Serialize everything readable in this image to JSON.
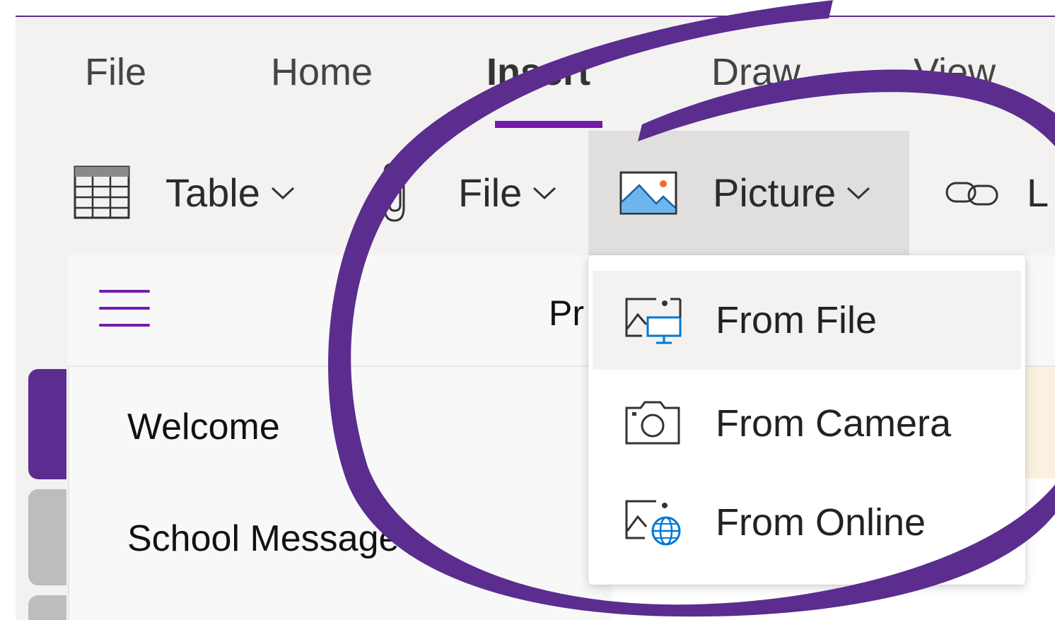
{
  "ribbon": {
    "tabs": [
      {
        "label": "File"
      },
      {
        "label": "Home"
      },
      {
        "label": "Insert",
        "active": true
      },
      {
        "label": "Draw"
      },
      {
        "label": "View"
      }
    ],
    "commands": {
      "table": "Table",
      "file": "File",
      "picture": "Picture",
      "link": "L"
    }
  },
  "navigation": {
    "page_title_partial": "Pr",
    "pages": [
      "Welcome",
      "School Messages"
    ]
  },
  "picture_menu": {
    "items": [
      {
        "label": "From File",
        "icon": "picture-from-file-icon"
      },
      {
        "label": "From Camera",
        "icon": "camera-icon"
      },
      {
        "label": "From Online",
        "icon": "picture-online-globe-icon"
      }
    ]
  },
  "colors": {
    "accent_purple": "#7719aa",
    "annotation_purple": "#5b2d8e",
    "ribbon_bg": "#f3f2f1",
    "hover_bg": "#e1dfdd",
    "icon_blue": "#0078d4"
  }
}
